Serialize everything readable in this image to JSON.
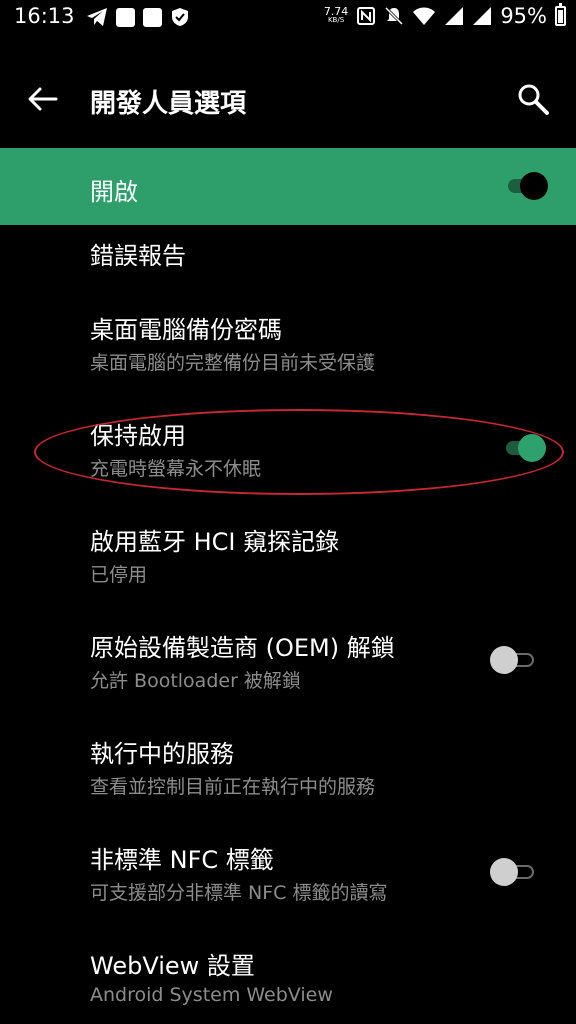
{
  "status_bar": {
    "time": "16:13",
    "speed_value": "7.74",
    "speed_unit": "KB/S",
    "battery": "95%"
  },
  "app_bar": {
    "title": "開發人員選項"
  },
  "master_switch": {
    "label": "開啟",
    "state": true
  },
  "items": [
    {
      "title": "錯誤報告",
      "subtitle": ""
    },
    {
      "title": "桌面電腦備份密碼",
      "subtitle": "桌面電腦的完整備份目前未受保護"
    },
    {
      "title": "保持啟用",
      "subtitle": "充電時螢幕永不休眠",
      "toggle": true
    },
    {
      "title": "啟用藍牙 HCI 窺探記錄",
      "subtitle": "已停用"
    },
    {
      "title": "原始設備製造商 (OEM) 解鎖",
      "subtitle": "允許 Bootloader 被解鎖",
      "toggle": false
    },
    {
      "title": "執行中的服務",
      "subtitle": "查看並控制目前正在執行中的服務"
    },
    {
      "title": "非標準 NFC 標籤",
      "subtitle": "可支援部分非標準 NFC 標籤的讀寫",
      "toggle": false
    },
    {
      "title": "WebView 設置",
      "subtitle": "Android System WebView"
    }
  ],
  "colors": {
    "accent": "#2e9e6a",
    "highlight": "#c62833",
    "background": "#000000"
  },
  "icons": [
    "telegram-icon",
    "notification-icon",
    "shield-icon",
    "nfc-icon",
    "mute-icon",
    "wifi-icon",
    "signal-icon",
    "battery-icon",
    "back-arrow-icon",
    "search-icon"
  ]
}
